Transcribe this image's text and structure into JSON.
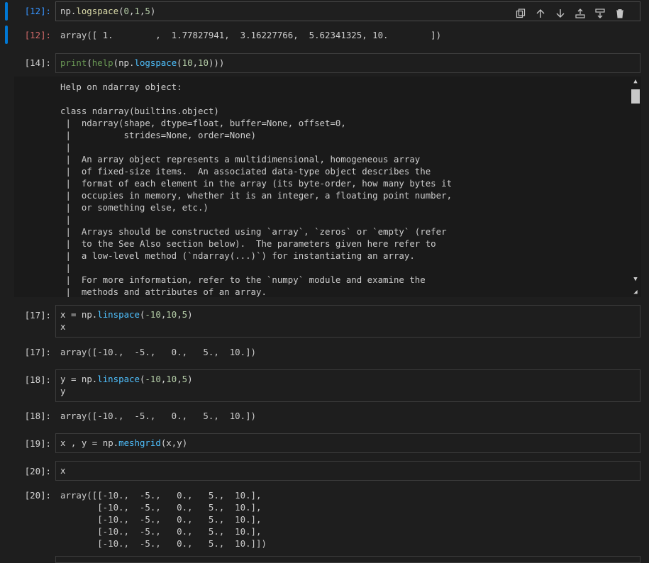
{
  "cells": {
    "c12_in": {
      "prompt": "[12]:"
    },
    "c12_out": {
      "prompt": "[12]:",
      "text": "array([ 1.        ,  1.77827941,  3.16227766,  5.62341325, 10.        ])"
    },
    "c14_in": {
      "prompt": "[14]:"
    },
    "help_lines": [
      "Help on ndarray object:",
      "",
      "class ndarray(builtins.object)",
      " |  ndarray(shape, dtype=float, buffer=None, offset=0,",
      " |          strides=None, order=None)",
      " |  ",
      " |  An array object represents a multidimensional, homogeneous array",
      " |  of fixed-size items.  An associated data-type object describes the",
      " |  format of each element in the array (its byte-order, how many bytes it",
      " |  occupies in memory, whether it is an integer, a floating point number,",
      " |  or something else, etc.)",
      " |  ",
      " |  Arrays should be constructed using `array`, `zeros` or `empty` (refer",
      " |  to the See Also section below).  The parameters given here refer to",
      " |  a low-level method (`ndarray(...)`) for instantiating an array.",
      " |  ",
      " |  For more information, refer to the `numpy` module and examine the",
      " |  methods and attributes of an array."
    ],
    "c17_in": {
      "prompt": "[17]:"
    },
    "c17_out": {
      "prompt": "[17]:",
      "text": "array([-10.,  -5.,   0.,   5.,  10.])"
    },
    "c18_in": {
      "prompt": "[18]:"
    },
    "c18_out": {
      "prompt": "[18]:",
      "text": "array([-10.,  -5.,   0.,   5.,  10.])"
    },
    "c19_in": {
      "prompt": "[19]:"
    },
    "c20_in": {
      "prompt": "[20]:",
      "code": "x"
    },
    "c20_out": {
      "prompt": "[20]:",
      "lines": [
        "array([[-10.,  -5.,   0.,   5.,  10.],",
        "       [-10.,  -5.,   0.,   5.,  10.],",
        "       [-10.,  -5.,   0.,   5.,  10.],",
        "       [-10.,  -5.,   0.,   5.,  10.],",
        "       [-10.,  -5.,   0.,   5.,  10.]])"
      ]
    }
  },
  "code_tokens": {
    "np": "np",
    "logspace": "logspace",
    "help": "help",
    "print": "print",
    "linspace": "linspace",
    "meshgrid": "meshgrid",
    "x": "x",
    "y": "y"
  },
  "toolbar": {
    "icons": [
      "copy-icon",
      "arrow-up-icon",
      "arrow-down-icon",
      "insert-above-icon",
      "insert-below-icon",
      "delete-icon"
    ]
  },
  "colors": {
    "accent": "#0078d4",
    "prompt_in": "#3794ff",
    "prompt_out": "#d16969",
    "number": "#b5cea8",
    "function": "#dcdcaa"
  }
}
